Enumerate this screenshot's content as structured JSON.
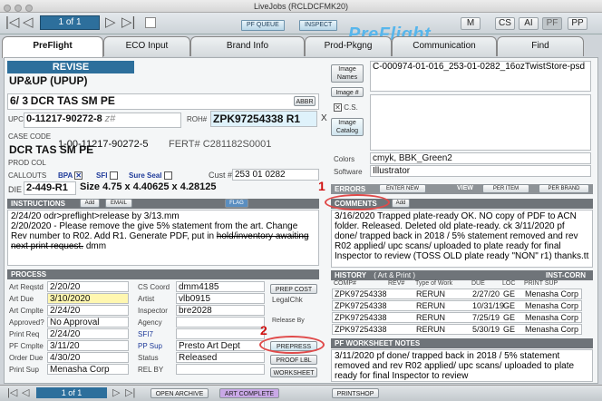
{
  "window": {
    "title": "LiveJobs (RCLDCFMK20)"
  },
  "toolbar": {
    "record": "1 of 1",
    "pf_queue": "PF QUEUE",
    "inspect": "INSPECT",
    "logo": "PreFlight",
    "m": "M",
    "cs": "CS",
    "ai": "AI",
    "pf": "PF",
    "pp": "PP"
  },
  "tabs": [
    "PreFlight",
    "ECO Input",
    "Brand Info",
    "Prod-Pkgng",
    "Communication",
    "Find"
  ],
  "left": {
    "revise": "REVISE",
    "upup": "UP&UP (UPUP)",
    "item_num": "6/ 3",
    "item_desc": "DCR TAS SM PE",
    "abbr": "ABBR",
    "upc_lbl": "UPC",
    "upc": "0-11217-90272-8",
    "upc_suffix": "z#",
    "roh_lbl": "ROH#",
    "roh": "ZPK97254338 R1",
    "x": "X",
    "case_code_lbl": "CASE CODE",
    "case_code": "1-00-11217-90272-5",
    "fert": "FERT# C281182S0001",
    "desc2": "DCR TAS SM PE",
    "prod_col": "PROD COL",
    "callouts": "CALLOUTS",
    "bpa": "BPA",
    "sfi": "SFI",
    "sure_seal": "Sure Seal",
    "cust_lbl": "Cust #",
    "cust": "253 01 0282",
    "die_lbl": "DIE",
    "die": "2-449-R1",
    "size": "Size 4.75 x 4.40625 x 4.28125"
  },
  "instructions": {
    "header": "INSTRUCTIONS",
    "add": "Add",
    "email": "EMAIL",
    "flag": "FLAG",
    "line1": "2/24/20 odr>preflight>release by 3/13.mm",
    "line2": "2/20/2020 - Please remove the give 5% statement from the art. Change Rev number to R02. Add R1. Generate PDF, put in ",
    "line2_struck": "hold/inventory awaiting next print request.",
    "line2_end": " dmm"
  },
  "process": {
    "header": "PROCESS",
    "rows": [
      {
        "label": "Art Reqstd",
        "value": "2/20/20"
      },
      {
        "label": "Art Due",
        "value": "3/10/2020"
      },
      {
        "label": "Art Cmplte",
        "value": "2/24/20"
      },
      {
        "label": "Approved?",
        "value": "No Approval"
      },
      {
        "label": "Print Req",
        "value": "2/24/20"
      },
      {
        "label": "PF Cmplte",
        "value": "3/11/20"
      },
      {
        "label": "Order Due",
        "value": "4/30/20"
      },
      {
        "label": "Print Sup",
        "value": "Menasha Corp"
      }
    ],
    "right_rows": [
      {
        "label": "CS Coord",
        "value": "dmm4185"
      },
      {
        "label": "Artist",
        "value": "vlb0915"
      },
      {
        "label": "Inspector",
        "value": "bre2028"
      },
      {
        "label": "Agency",
        "value": ""
      },
      {
        "label": "SFI7",
        "value": ""
      },
      {
        "label": "PP Sup",
        "value": "Presto Art Dept"
      },
      {
        "label": "Status",
        "value": "Released"
      },
      {
        "label": "REL BY",
        "value": ""
      }
    ],
    "prep_cost": "PREP COST",
    "legal_chk": "LegalChk",
    "release_by": "Release By",
    "prepress": "PREPRESS",
    "proof_lbl": "PROOF LBL",
    "worksheet": "WORKSHEET"
  },
  "right": {
    "image_names_lbl": "Image Names",
    "image_names": "C-000974-01-016_253-01-0282_16ozTwistStore-psd",
    "image_num_lbl": "Image #",
    "cs": "C.S.",
    "image_catalog": "Image Catalog",
    "colors_lbl": "Colors",
    "colors": "cmyk, BBK_Green2",
    "software_lbl": "Software",
    "software": "Illustrator",
    "errors": "ERRORS",
    "enter_new": "ENTER NEW",
    "view": "VIEW",
    "per_item": "PER ITEM",
    "per_brand": "PER BRAND",
    "comments": "COMMENTS",
    "comments_add": "Add",
    "comments_text": "3/16/2020 Trapped plate-ready OK. NO copy of PDF to ACN folder. Released. Deleted old plate-ready. ck 3/11/2020 pf done/ trapped back in 2018 / 5% statement removed and rev R02 applied/ upc scans/ uploaded to plate ready for final Inspector to review (TOSS OLD plate ready \"NON\" r1) thanks.tt",
    "history": "HISTORY",
    "history_sub": "( Art & Print )",
    "inst_corn": "INST-CORN",
    "hist_cols": [
      "COMP#",
      "REV#",
      "Type of Work",
      "DUE",
      "LOC",
      "PRINT SUP"
    ],
    "hist_rows": [
      [
        "ZPK97254338",
        "",
        "RERUN",
        "2/27/20",
        "GE",
        "Menasha Corp"
      ],
      [
        "ZPK97254338",
        "",
        "RERUN",
        "10/31/19",
        "GE",
        "Menasha Corp"
      ],
      [
        "ZPK97254338",
        "",
        "RERUN",
        "7/25/19",
        "GE",
        "Menasha Corp"
      ],
      [
        "ZPK97254338",
        "",
        "RERUN",
        "5/30/19",
        "GE",
        "Menasha Corp"
      ]
    ],
    "pf_notes": "PF WORKSHEET NOTES",
    "pf_notes_text": "3/11/2020 pf done/ trapped back in 2018 / 5% statement removed and rev R02 applied/ upc scans/ uploaded to plate ready for final Inspector to review"
  },
  "bottom": {
    "record": "1 of 1",
    "open_archive": "OPEN ARCHIVE",
    "art_complete": "ART COMPLETE",
    "printshop": "PRINTSHOP"
  },
  "annotations": {
    "one": "1",
    "two": "2"
  },
  "colors": {
    "accent": "#57b6ec",
    "revise": "#2d6f9c",
    "highlight_yellow": "#fff7b0",
    "oval": "#e04a4a"
  }
}
